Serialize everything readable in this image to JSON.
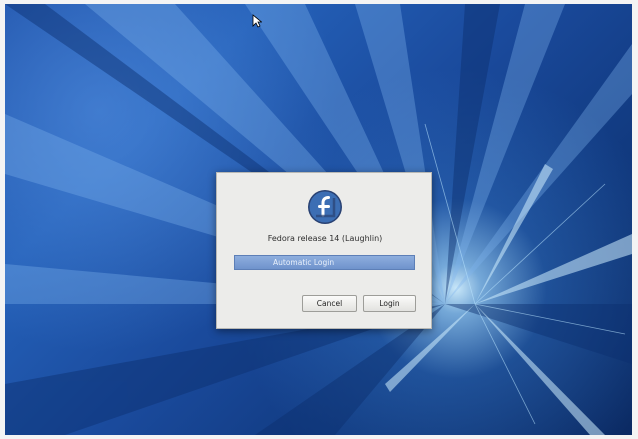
{
  "desktop": {
    "wallpaper": "fedora-blue-burst",
    "accent": "#1a4a9c",
    "cursor_icon": "mouse-pointer-icon"
  },
  "login_dialog": {
    "logo_icon": "fedora-logo-icon",
    "release_text": "Fedora release 14 (Laughlin)",
    "user_entry": "Automatic Login",
    "cancel_label": "Cancel",
    "login_label": "Login",
    "highlight_color": "#7a9bd2"
  }
}
